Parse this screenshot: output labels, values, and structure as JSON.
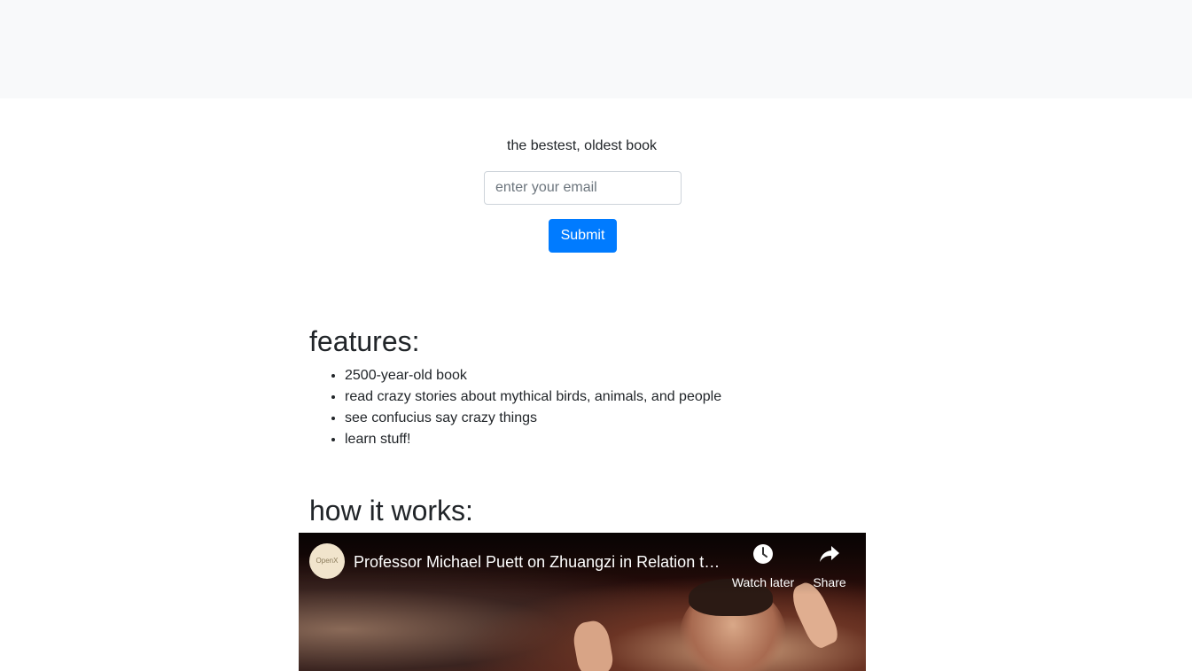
{
  "hero": {
    "tagline": "the bestest, oldest book",
    "email_placeholder": "enter your email",
    "submit_label": "Submit"
  },
  "features": {
    "heading": "features:",
    "items": [
      "2500-year-old book",
      "read crazy stories about mythical birds, animals, and people",
      "see confucius say crazy things",
      "learn stuff!"
    ]
  },
  "how_it_works": {
    "heading": "how it works:"
  },
  "video": {
    "channel_logo_text": "OpenX",
    "title": "Professor Michael Puett on Zhuangzi in Relation to …",
    "watch_later_label": "Watch later",
    "share_label": "Share",
    "watch_later_icon": "clock-icon",
    "share_icon": "share-arrow-icon"
  },
  "colors": {
    "header_band": "#f8f9fa",
    "primary_button": "#007bff",
    "text": "#212529"
  }
}
